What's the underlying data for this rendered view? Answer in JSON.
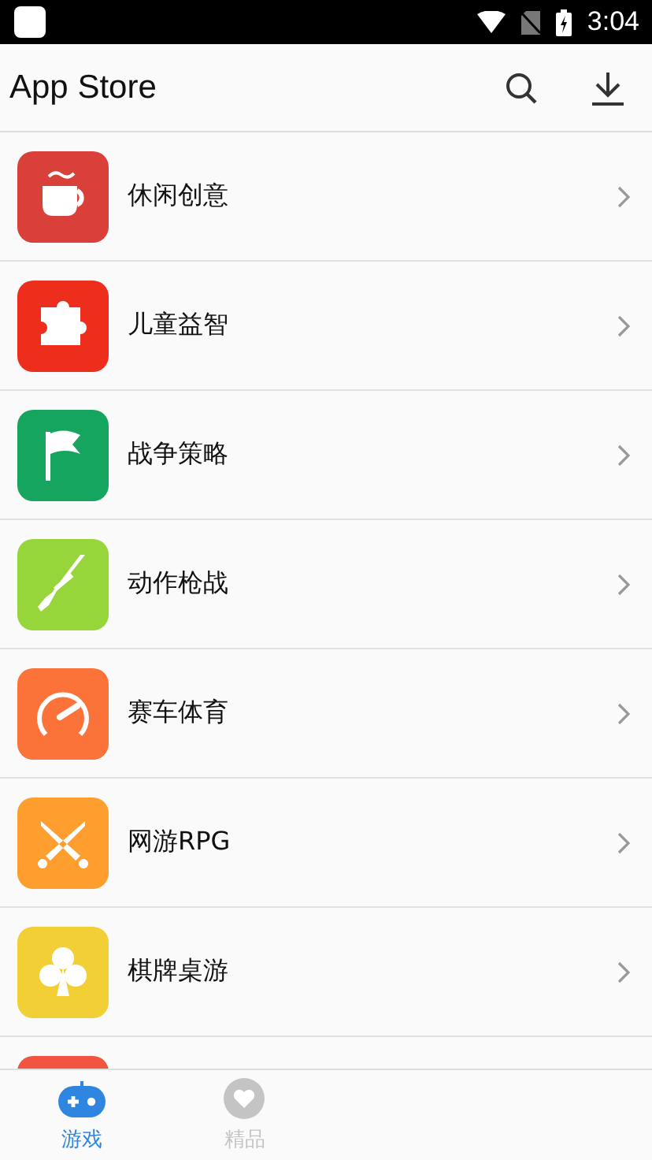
{
  "status_bar": {
    "time": "3:04"
  },
  "app_bar": {
    "title": "App Store"
  },
  "categories": [
    {
      "label": "休闲创意",
      "color": "#d9403a"
    },
    {
      "label": "儿童益智",
      "color": "#ee2e1c"
    },
    {
      "label": "战争策略",
      "color": "#16a55e"
    },
    {
      "label": "动作枪战",
      "color": "#96d63a"
    },
    {
      "label": "赛车体育",
      "color": "#fb7338"
    },
    {
      "label": "网游RPG",
      "color": "#fd9e2e"
    },
    {
      "label": "棋牌桌游",
      "color": "#f1cf35"
    },
    {
      "color": "#f1543f"
    }
  ],
  "tabs": [
    {
      "label": "游戏",
      "selected": true
    },
    {
      "label": "精品",
      "selected": false
    }
  ]
}
